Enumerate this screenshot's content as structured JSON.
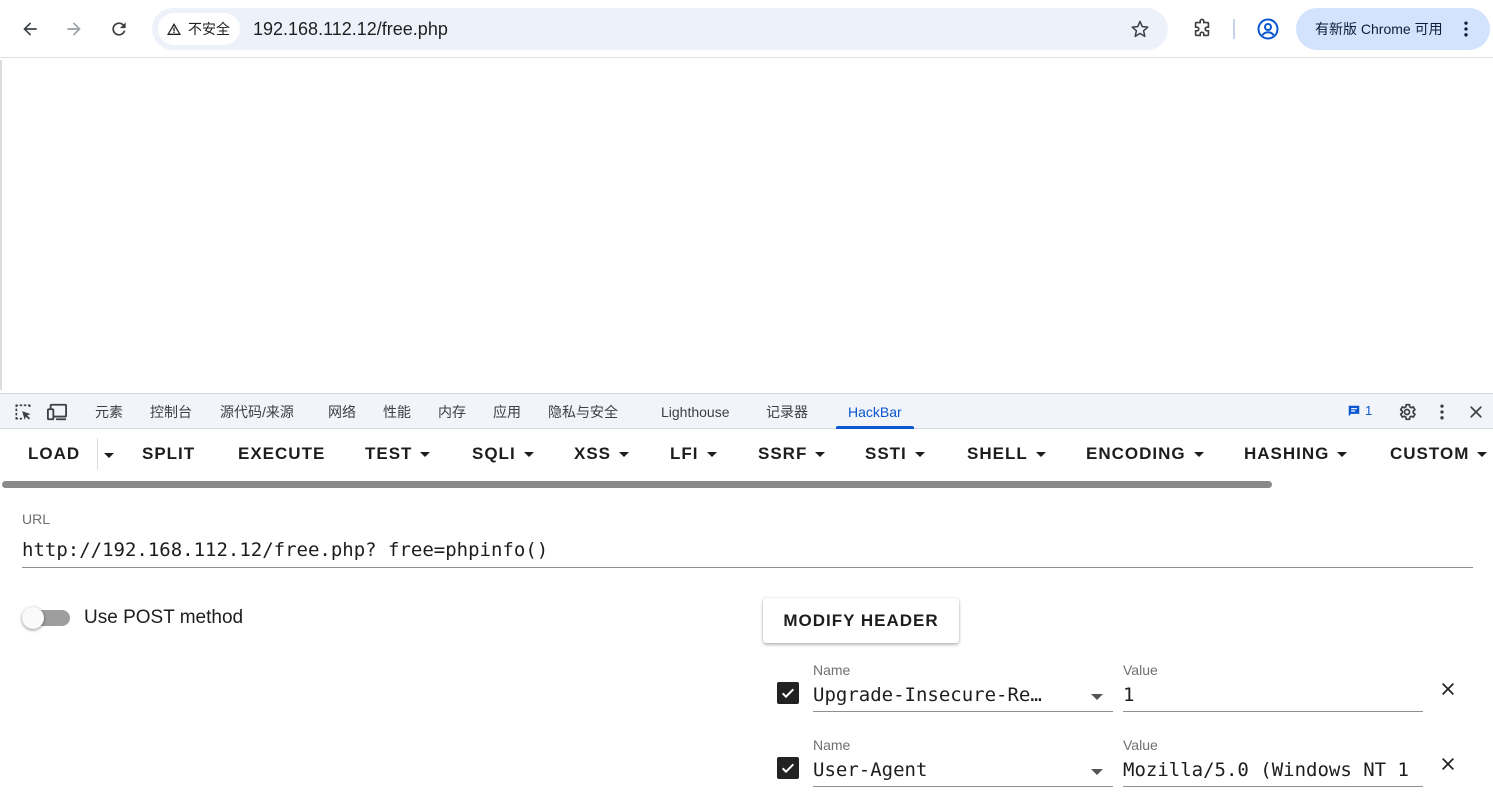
{
  "browser": {
    "security_label": "不安全",
    "url": "192.168.112.12/free.php",
    "update_label": "有新版 Chrome 可用"
  },
  "devtools": {
    "tabs": [
      {
        "label": "元素"
      },
      {
        "label": "控制台"
      },
      {
        "label": "源代码/来源"
      },
      {
        "label": "网络"
      },
      {
        "label": "性能"
      },
      {
        "label": "内存"
      },
      {
        "label": "应用"
      },
      {
        "label": "隐私与安全"
      },
      {
        "label": "Lighthouse"
      },
      {
        "label": "记录器"
      },
      {
        "label": "HackBar"
      }
    ],
    "active_tab": "HackBar",
    "issues_count": "1"
  },
  "hackbar": {
    "menu": [
      {
        "label": "LOAD"
      },
      {
        "label": "SPLIT"
      },
      {
        "label": "EXECUTE"
      },
      {
        "label": "TEST"
      },
      {
        "label": "SQLI"
      },
      {
        "label": "XSS"
      },
      {
        "label": "LFI"
      },
      {
        "label": "SSRF"
      },
      {
        "label": "SSTI"
      },
      {
        "label": "SHELL"
      },
      {
        "label": "ENCODING"
      },
      {
        "label": "HASHING"
      },
      {
        "label": "CUSTOM"
      }
    ],
    "url_label": "URL",
    "url_value": "http://192.168.112.12/free.php? free=phpinfo()",
    "post_label": "Use POST method",
    "post_enabled": false,
    "modify_header_label": "MODIFY HEADER",
    "headers": [
      {
        "name_label": "Name",
        "name": "Upgrade-Insecure-Re…",
        "value_label": "Value",
        "value": "1",
        "enabled": true
      },
      {
        "name_label": "Name",
        "name": "User-Agent",
        "value_label": "Value",
        "value": "Mozilla/5.0 (Windows NT 1",
        "enabled": true
      }
    ]
  },
  "colors": {
    "accent": "#0b57d0",
    "omnibox_bg": "#edf2fa",
    "update_chip_bg": "#d3e3fd"
  }
}
